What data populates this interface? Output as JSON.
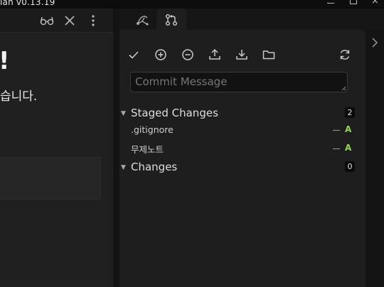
{
  "window": {
    "title": "ian v0.13.19"
  },
  "editor": {
    "header_icons": [
      "glasses-icon",
      "close-icon",
      "more-vertical-icon"
    ],
    "doc_exclaim": "!",
    "doc_text": "습니다."
  },
  "sidebar": {
    "tabs": [
      {
        "name": "graph-tab",
        "icon": "graph-icon"
      },
      {
        "name": "source-control-tab",
        "icon": "git-branch-icon"
      }
    ],
    "toolbar": [
      "commit-check-icon",
      "stage-all-plus-icon",
      "unstage-all-minus-icon",
      "push-upload-icon",
      "pull-download-icon",
      "open-folder-icon",
      "refresh-icon"
    ],
    "commit_message": {
      "placeholder": "Commit Message",
      "value": ""
    },
    "staged": {
      "title": "Staged Changes",
      "count": "2",
      "files": [
        {
          "name": ".gitignore",
          "status": "A"
        },
        {
          "name": "무제노트",
          "status": "A"
        }
      ]
    },
    "changes": {
      "title": "Changes",
      "count": "0"
    }
  },
  "colors": {
    "background": "#161616",
    "editor": "#202020",
    "sidebar": "#1e1e1e",
    "added_status": "#8fd94e"
  }
}
